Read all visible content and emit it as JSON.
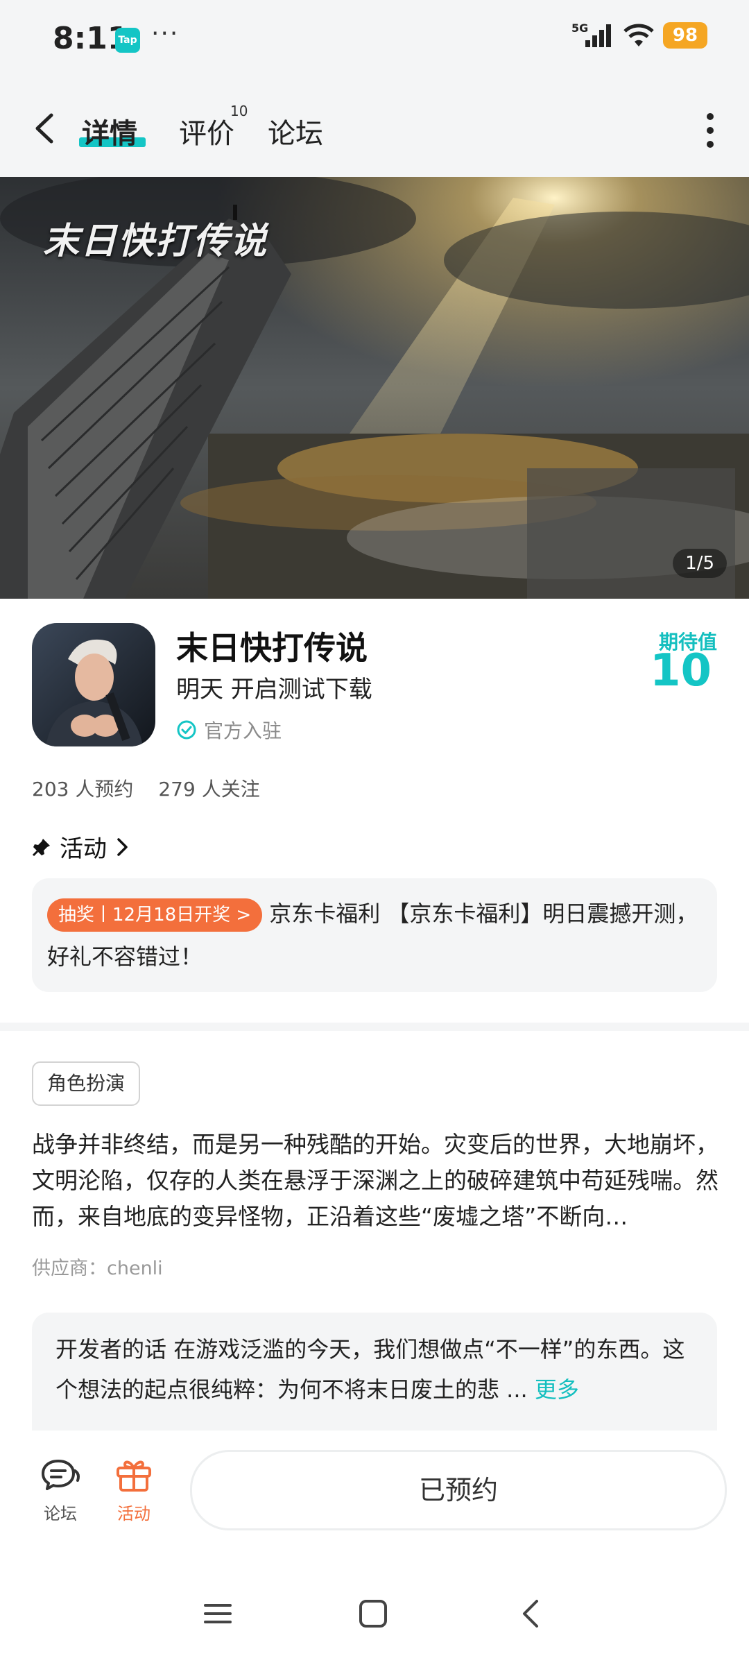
{
  "status_bar": {
    "time": "8:11",
    "app_badge": "Tap",
    "dots": "···",
    "network": "5G",
    "battery": "98"
  },
  "nav": {
    "tabs": [
      {
        "label": "详情",
        "active": true
      },
      {
        "label": "评价",
        "count": "10"
      },
      {
        "label": "论坛"
      }
    ]
  },
  "hero": {
    "logo_text": "末日快打传说",
    "pager": "1/5"
  },
  "game": {
    "title": "末日快打传说",
    "subtitle": "明天 开启测试下载",
    "official": "官方入驻",
    "expect_label": "期待值",
    "expect_value": "10",
    "reservations": "203 人预约",
    "follows": "279 人关注"
  },
  "activity": {
    "heading": "活动",
    "badge": "抽奖丨12月18日开奖 >",
    "text": "京东卡福利 【京东卡福利】明日震撼开测，好礼不容错过！"
  },
  "details": {
    "tag": "角色扮演",
    "description": "战争并非终结，而是另一种残酷的开始。灾变后的世界，大地崩坏，文明沦陷，仅存的人类在悬浮于深渊之上的破碎建筑中苟延残喘。然而，来自地底的变异怪物，正沿着这些“废墟之塔”不断向…",
    "supplier": "供应商：chenli"
  },
  "developer": {
    "label": "开发者的话",
    "text": "在游戏泛滥的今天，我们想做点“不一样”的东西。这个想法的起点很纯粹：为何不将末日废土的悲 ...",
    "more": "更多"
  },
  "bottom_bar": {
    "forum_label": "论坛",
    "activity_label": "活动",
    "reserve_label": "已预约"
  },
  "colors": {
    "accent": "#14c5c5",
    "orange": "#f36f3c",
    "battery": "#f5a623"
  }
}
